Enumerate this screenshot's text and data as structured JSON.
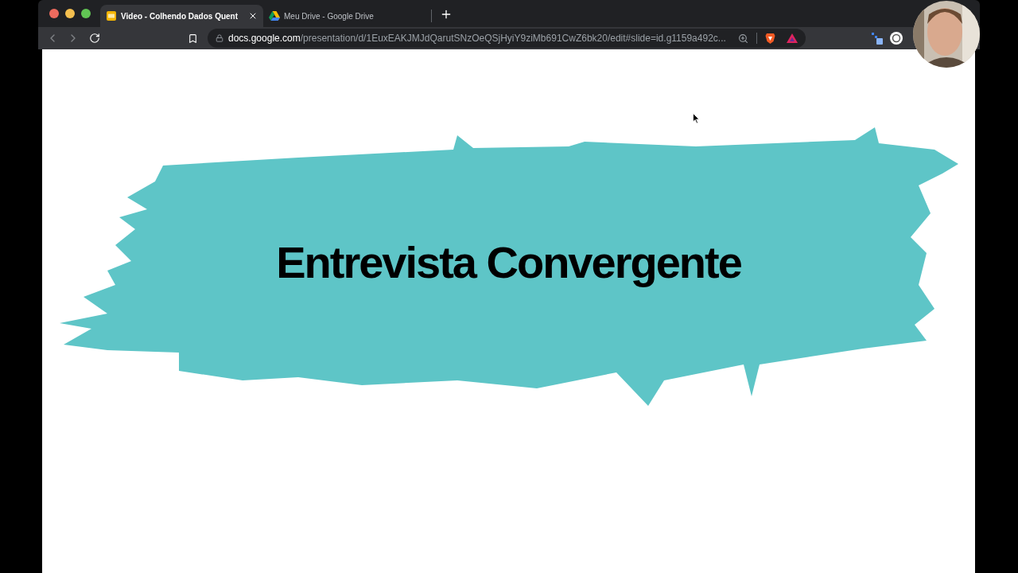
{
  "browser": {
    "tabs": [
      {
        "title": "Video - Colhendo Dados Quent",
        "kind": "slides",
        "selected": true
      },
      {
        "title": "Meu Drive - Google Drive",
        "kind": "drive",
        "selected": false
      }
    ],
    "address": {
      "host": "docs.google.com",
      "path": "/presentation/d/1EuxEAKJMJdQarutSNzOeQSjHyiY9ziMb691CwZ6bk20/edit#slide=id.g1159a492c..."
    }
  },
  "slide": {
    "title": "Entrevista Convergente"
  }
}
